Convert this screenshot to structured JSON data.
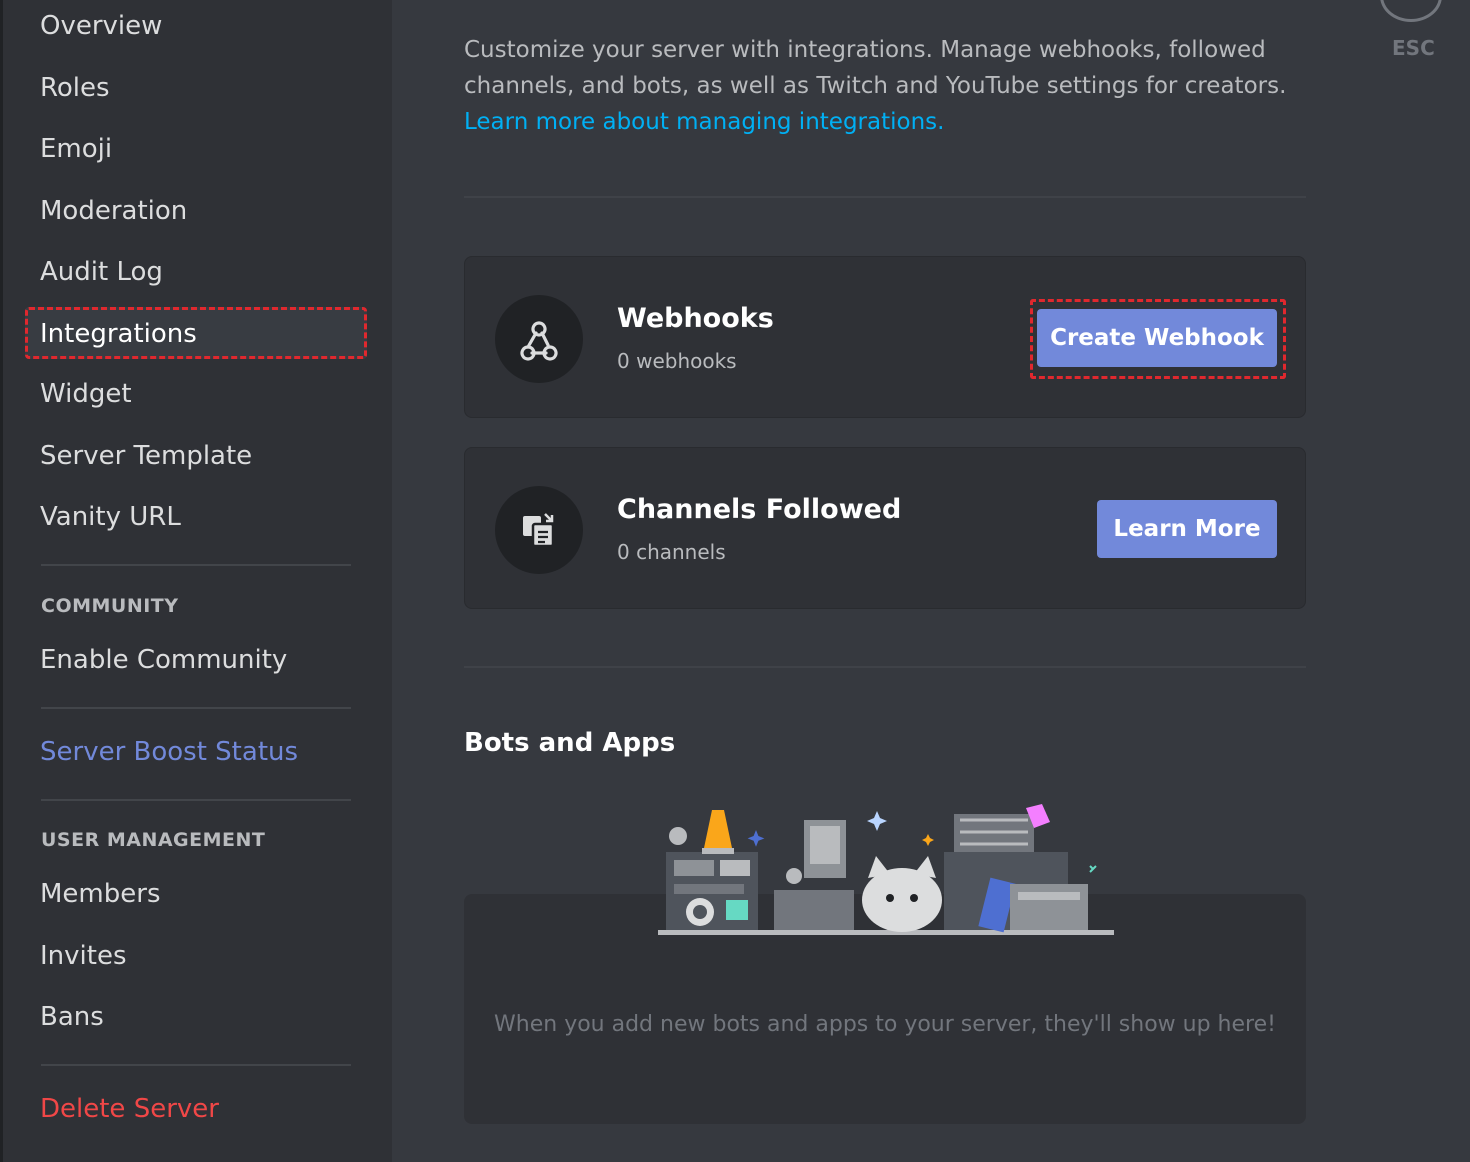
{
  "sidebar": {
    "items": [
      {
        "label": "Overview"
      },
      {
        "label": "Roles"
      },
      {
        "label": "Emoji"
      },
      {
        "label": "Moderation"
      },
      {
        "label": "Audit Log"
      },
      {
        "label": "Integrations",
        "selected": true
      },
      {
        "label": "Widget"
      },
      {
        "label": "Server Template"
      },
      {
        "label": "Vanity URL"
      }
    ],
    "community_header": "COMMUNITY",
    "enable_community": "Enable Community",
    "server_boost": "Server Boost Status",
    "user_management_header": "USER MANAGEMENT",
    "user_items": [
      {
        "label": "Members"
      },
      {
        "label": "Invites"
      },
      {
        "label": "Bans"
      }
    ],
    "delete_server": "Delete Server"
  },
  "main": {
    "description": "Customize your server with integrations. Manage webhooks, followed channels, and bots, as well as Twitch and YouTube settings for creators.",
    "learn_more_link": "Learn more about managing integrations.",
    "webhooks": {
      "title": "Webhooks",
      "count": "0 webhooks",
      "button": "Create Webhook",
      "icon": "webhook-icon"
    },
    "channels_followed": {
      "title": "Channels Followed",
      "count": "0 channels",
      "button": "Learn More",
      "icon": "channel-follow-icon"
    },
    "bots_and_apps": {
      "title": "Bots and Apps",
      "empty_message": "When you add new bots and apps to your server, they'll show up here!"
    }
  },
  "close": {
    "label": "ESC",
    "icon": "close-icon"
  },
  "colors": {
    "accent": "#7289da",
    "danger": "#f04747",
    "link": "#00b0f4",
    "highlight_outline": "#e0282e"
  }
}
